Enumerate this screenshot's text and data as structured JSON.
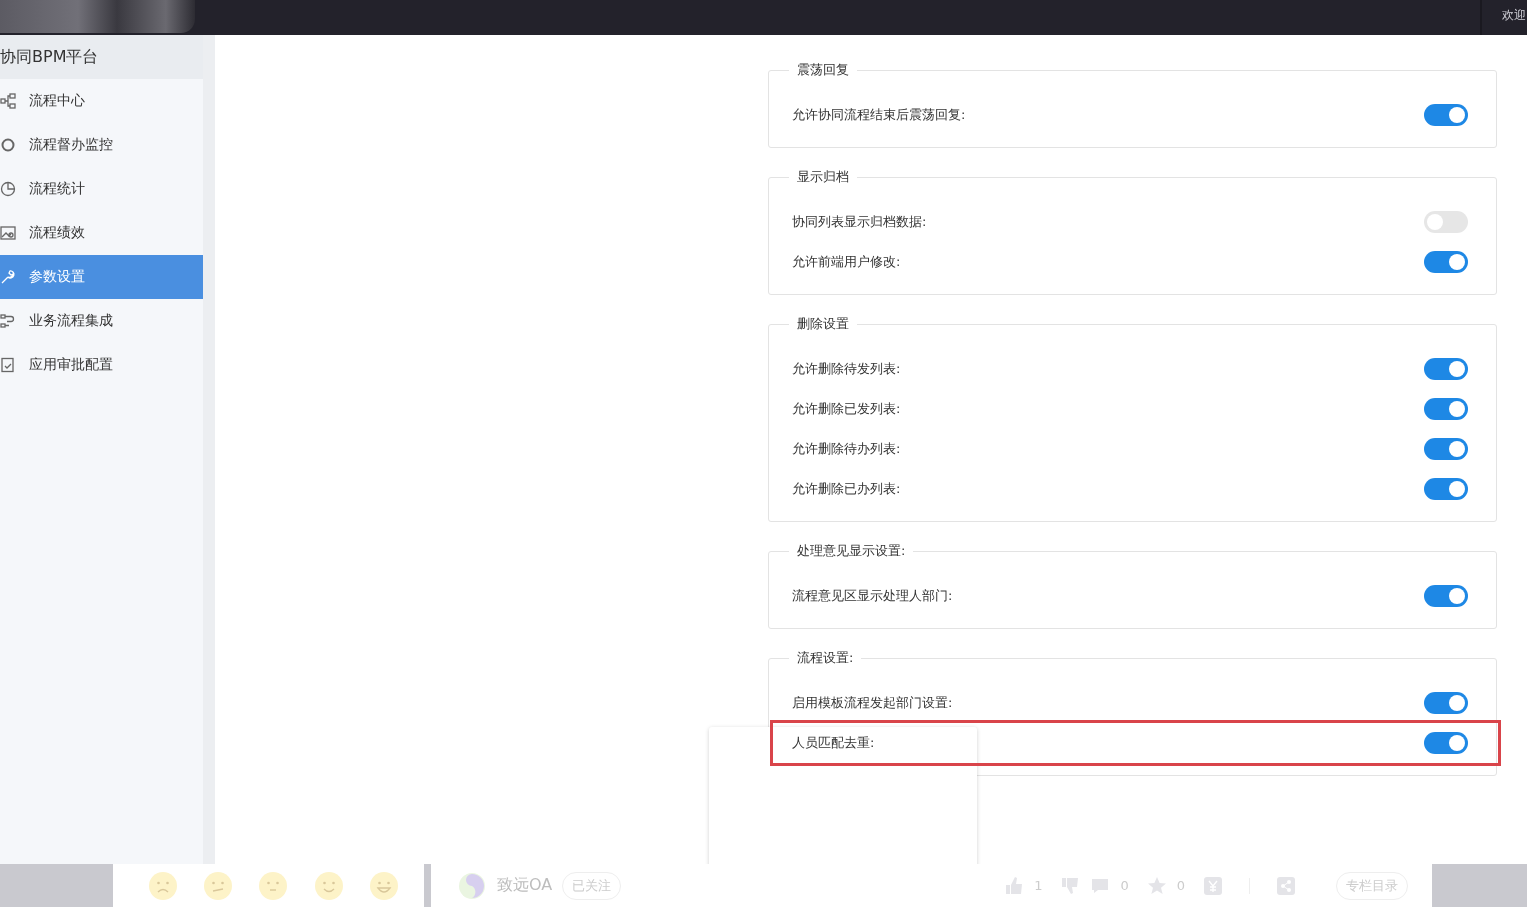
{
  "topbar": {
    "welcome": "欢迎"
  },
  "sidebar": {
    "title": "协同BPM平台",
    "items": [
      {
        "label": "流程中心",
        "selected": false
      },
      {
        "label": "流程督办监控",
        "selected": false
      },
      {
        "label": "流程统计",
        "selected": false
      },
      {
        "label": "流程绩效",
        "selected": false
      },
      {
        "label": "参数设置",
        "selected": true
      },
      {
        "label": "业务流程集成",
        "selected": false
      },
      {
        "label": "应用审批配置",
        "selected": false
      }
    ]
  },
  "sections": [
    {
      "title": "震荡回复",
      "rows": [
        {
          "label": "允许协同流程结束后震荡回复:",
          "on": true,
          "highlighted": false
        }
      ]
    },
    {
      "title": "显示归档",
      "rows": [
        {
          "label": "协同列表显示归档数据:",
          "on": false,
          "highlighted": false
        },
        {
          "label": "允许前端用户修改:",
          "on": true,
          "highlighted": false
        }
      ]
    },
    {
      "title": "删除设置",
      "rows": [
        {
          "label": "允许删除待发列表:",
          "on": true,
          "highlighted": false
        },
        {
          "label": "允许删除已发列表:",
          "on": true,
          "highlighted": false
        },
        {
          "label": "允许删除待办列表:",
          "on": true,
          "highlighted": false
        },
        {
          "label": "允许删除已办列表:",
          "on": true,
          "highlighted": false
        }
      ]
    },
    {
      "title": "处理意见显示设置:",
      "rows": [
        {
          "label": "流程意见区显示处理人部门:",
          "on": true,
          "highlighted": false
        }
      ]
    },
    {
      "title": "流程设置:",
      "rows": [
        {
          "label": "启用模板流程发起部门设置:",
          "on": true,
          "highlighted": false
        },
        {
          "label": "人员匹配去重:",
          "on": true,
          "highlighted": true
        }
      ]
    }
  ],
  "bottom_bar": {
    "author": "致远OA",
    "follow_button": "已关注",
    "likes": "1",
    "comments": "0",
    "favorites": "0",
    "catalog_button": "专栏目录"
  }
}
